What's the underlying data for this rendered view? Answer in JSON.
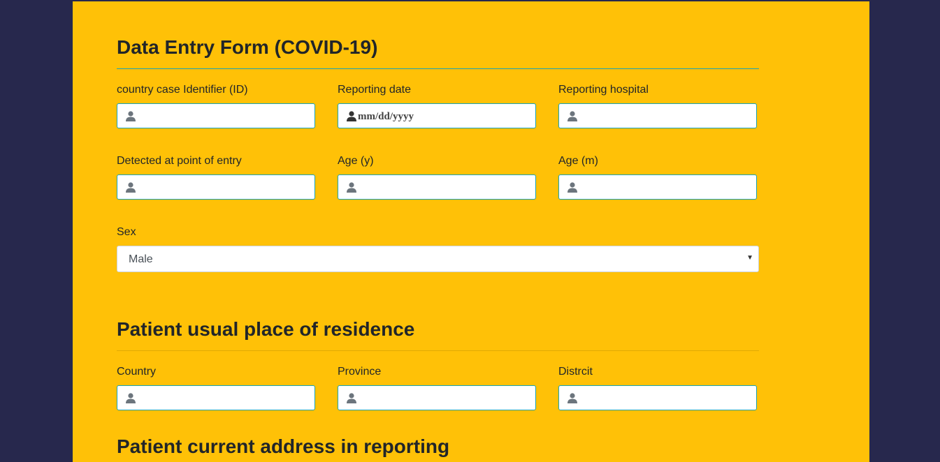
{
  "form": {
    "title": "Data Entry Form (COVID-19)",
    "fields": [
      {
        "label": "country case Identifier (ID)",
        "value": "",
        "placeholder": ""
      },
      {
        "label": "Reporting date",
        "value": "",
        "placeholder": "mm/dd/yyyy"
      },
      {
        "label": "Reporting hospital",
        "value": "",
        "placeholder": ""
      },
      {
        "label": "Detected at point of entry",
        "value": "",
        "placeholder": ""
      },
      {
        "label": "Age (y)",
        "value": "",
        "placeholder": ""
      },
      {
        "label": "Age (m)",
        "value": "",
        "placeholder": ""
      }
    ],
    "sex": {
      "label": "Sex",
      "selected": "Male"
    }
  },
  "residence": {
    "title": "Patient usual place of residence",
    "fields": [
      {
        "label": "Country",
        "value": "",
        "placeholder": ""
      },
      {
        "label": "Province",
        "value": "",
        "placeholder": ""
      },
      {
        "label": "Distrcit",
        "value": "",
        "placeholder": ""
      }
    ]
  },
  "current_address": {
    "title": "Patient current address in reporting"
  },
  "icons": {
    "field_icon": "user-icon",
    "select_icon": "chevron-down-icon"
  },
  "colors": {
    "background": "#27284d",
    "panel": "#ffc107",
    "input_border": "#17a2b8",
    "icon": "#6c757d"
  }
}
